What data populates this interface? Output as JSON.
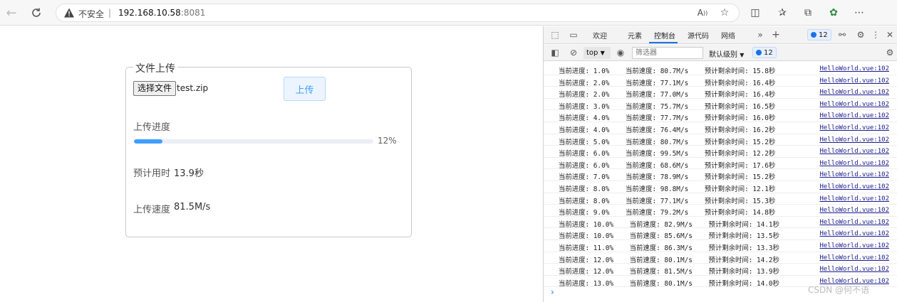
{
  "browser": {
    "insecure_label": "不安全",
    "separator": "|",
    "url_host": "192.168.10.58",
    "url_port": ":8081"
  },
  "page": {
    "legend": "文件上传",
    "choose_file_label": "选择文件",
    "file_name": "test.zip",
    "upload_button": "上传",
    "progress_title": "上传进度",
    "progress_percent": 12,
    "progress_text": "12%",
    "eta_label": "预计用时",
    "eta_value": "13.9秒",
    "speed_label": "上传速度",
    "speed_value": "81.5M/s",
    "accent_color": "#409eff"
  },
  "devtools": {
    "tabs": [
      "欢迎",
      "元素",
      "控制台",
      "源代码",
      "网络"
    ],
    "active_tab": "控制台",
    "message_count": "12",
    "context": "top",
    "filter_placeholder": "筛选器",
    "level": "默认级别",
    "logs": [
      {
        "text": "当前进度: 1.0%    当前速度: 80.7M/s    预计剩余时间: 15.8秒",
        "src": "HelloWorld.vue:102"
      },
      {
        "text": "当前进度: 2.0%    当前速度: 77.1M/s    预计剩余时间: 16.4秒",
        "src": "HelloWorld.vue:102"
      },
      {
        "text": "当前进度: 2.0%    当前速度: 77.0M/s    预计剩余时间: 16.4秒",
        "src": "HelloWorld.vue:102"
      },
      {
        "text": "当前进度: 3.0%    当前速度: 75.7M/s    预计剩余时间: 16.5秒",
        "src": "HelloWorld.vue:102"
      },
      {
        "text": "当前进度: 4.0%    当前速度: 77.7M/s    预计剩余时间: 16.0秒",
        "src": "HelloWorld.vue:102"
      },
      {
        "text": "当前进度: 4.0%    当前速度: 76.4M/s    预计剩余时间: 16.2秒",
        "src": "HelloWorld.vue:102"
      },
      {
        "text": "当前进度: 5.0%    当前速度: 80.7M/s    预计剩余时间: 15.2秒",
        "src": "HelloWorld.vue:102"
      },
      {
        "text": "当前进度: 6.0%    当前速度: 99.5M/s    预计剩余时间: 12.2秒",
        "src": "HelloWorld.vue:102"
      },
      {
        "text": "当前进度: 6.0%    当前速度: 68.6M/s    预计剩余时间: 17.6秒",
        "src": "HelloWorld.vue:102"
      },
      {
        "text": "当前进度: 7.0%    当前速度: 78.9M/s    预计剩余时间: 15.2秒",
        "src": "HelloWorld.vue:102"
      },
      {
        "text": "当前进度: 8.0%    当前速度: 98.8M/s    预计剩余时间: 12.1秒",
        "src": "HelloWorld.vue:102"
      },
      {
        "text": "当前进度: 8.0%    当前速度: 77.1M/s    预计剩余时间: 15.3秒",
        "src": "HelloWorld.vue:102"
      },
      {
        "text": "当前进度: 9.0%    当前速度: 79.2M/s    预计剩余时间: 14.8秒",
        "src": "HelloWorld.vue:102"
      },
      {
        "text": "当前进度: 10.0%    当前速度: 82.9M/s    预计剩余时间: 14.1秒",
        "src": "HelloWorld.vue:102"
      },
      {
        "text": "当前进度: 10.0%    当前速度: 85.6M/s    预计剩余时间: 13.5秒",
        "src": "HelloWorld.vue:102"
      },
      {
        "text": "当前进度: 11.0%    当前速度: 86.3M/s    预计剩余时间: 13.3秒",
        "src": "HelloWorld.vue:102"
      },
      {
        "text": "当前进度: 12.0%    当前速度: 80.1M/s    预计剩余时间: 14.2秒",
        "src": "HelloWorld.vue:102"
      },
      {
        "text": "当前进度: 12.0%    当前速度: 81.5M/s    预计剩余时间: 13.9秒",
        "src": "HelloWorld.vue:102"
      },
      {
        "text": "当前进度: 13.0%    当前速度: 80.1M/s    预计剩余时间: 14.0秒",
        "src": "HelloWorld.vue:102"
      }
    ]
  },
  "watermark": "CSDN @何不语"
}
